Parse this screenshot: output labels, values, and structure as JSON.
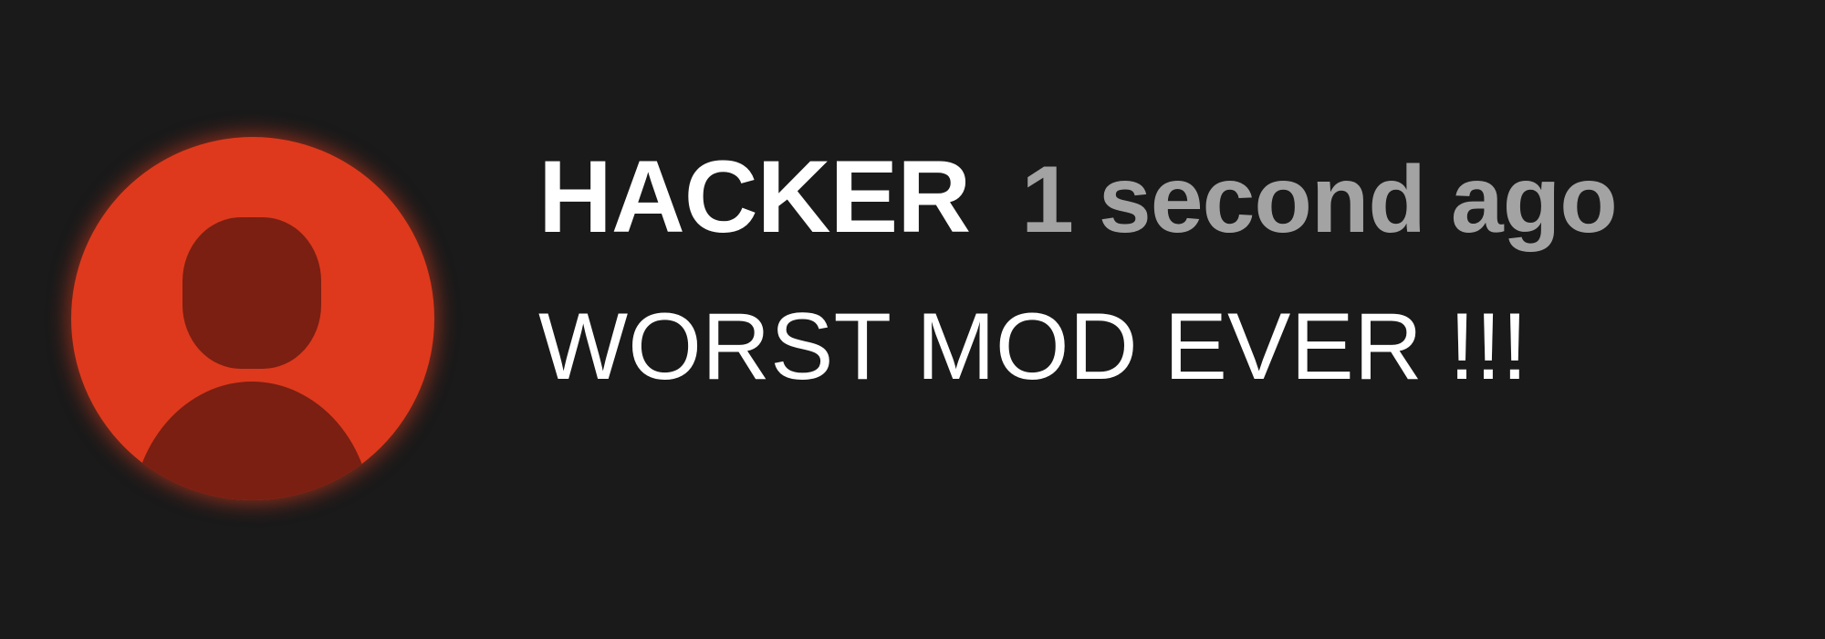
{
  "comment": {
    "avatar": {
      "icon": "user-silhouette-icon",
      "background_color": "#de391c",
      "figure_color": "#7a1f12"
    },
    "author": "HACKER",
    "timestamp": "1 second ago",
    "text": "WORST MOD EVER !!!"
  },
  "colors": {
    "background": "#1a1a1a",
    "author": "#ffffff",
    "timestamp": "#a3a3a3",
    "text": "#ffffff"
  }
}
